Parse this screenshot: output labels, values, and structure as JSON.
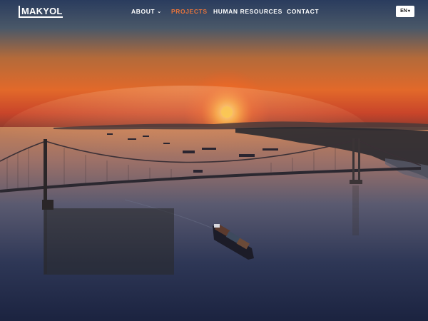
{
  "header": {
    "logo_text": "MAKYOL",
    "nav": {
      "about": "ABOUT",
      "projects": "PROJECTS",
      "human_resources": "HUMAN RESOURCES",
      "contact": "CONTACT"
    },
    "language": "EN"
  },
  "icons": {
    "about_chevron": "chevron-down-icon",
    "language_caret": "caret-down-icon"
  },
  "colors": {
    "active_nav": "#e8743b",
    "nav_text": "#ffffff",
    "sun": "#ffd84a"
  }
}
